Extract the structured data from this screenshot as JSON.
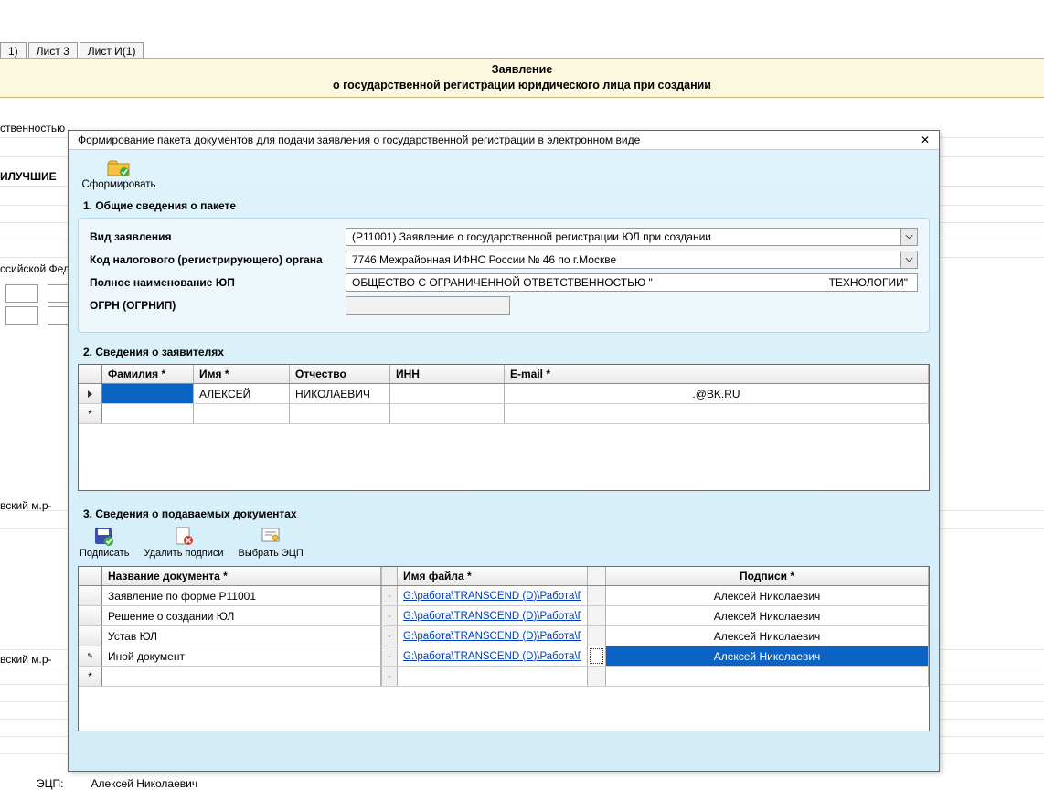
{
  "bg": {
    "tabs": [
      "1)",
      "Лист 3",
      "Лист И(1)"
    ],
    "title_line1": "Заявление",
    "title_line2": "о государственной регистрации юридического лица при создании",
    "cut1": "ственностью",
    "cut2": "ИЛУЧШИЕ",
    "cut3": "ссийской Фед",
    "cut4": "вский м.р-",
    "cut5": "вский м.р-",
    "ecp_label": "ЭЦП:",
    "ecp_value": "Алексей Николаевич"
  },
  "dialog": {
    "title": "Формирование пакета документов для подачи заявления о государственной регистрации в электронном виде",
    "toolbar": {
      "form_label": "Сформировать"
    },
    "section1": {
      "title": "1. Общие сведения о пакете",
      "labels": {
        "vid": "Вид заявления",
        "kod": "Код налогового (регистрирующего) органа",
        "name": "Полное наименование ЮП",
        "ogrn": "ОГРН (ОГРНИП)"
      },
      "values": {
        "vid": "(Р11001) Заявление о государственной регистрации ЮЛ при создании",
        "kod": "7746 Межрайонная ИФНС России № 46 по г.Москве",
        "name_left": "ОБЩЕСТВО С ОГРАНИЧЕННОЙ ОТВЕТСТВЕННОСТЬЮ \"",
        "name_right": "ТЕХНОЛОГИИ\"",
        "ogrn": ""
      }
    },
    "section2": {
      "title": "2. Сведения о заявителях",
      "headers": {
        "fam": "Фамилия *",
        "name": "Имя *",
        "ot": "Отчество",
        "inn": "ИНН",
        "email": "E-mail *"
      },
      "rows": [
        {
          "fam": "",
          "name": "АЛЕКСЕЙ",
          "ot": "НИКОЛАЕВИЧ",
          "inn": "",
          "email": ".@BK.RU"
        }
      ]
    },
    "section3": {
      "title": "3.  Сведения о подаваемых документах",
      "toolbar": {
        "sign": "Подписать",
        "unsign": "Удалить подписи",
        "choose": "Выбрать ЭЦП"
      },
      "headers": {
        "doc": "Название документа *",
        "file": "Имя файла *",
        "sign": "Подписи *"
      },
      "rows": [
        {
          "doc": "Заявление по форме Р11001",
          "file": "G:\\работа\\TRANSCEND (D)\\Работа\\П...",
          "sign": "Алексей Николаевич"
        },
        {
          "doc": "Решение о создании ЮЛ",
          "file": "G:\\работа\\TRANSCEND (D)\\Работа\\П...",
          "sign": "Алексей Николаевич"
        },
        {
          "doc": "Устав ЮЛ",
          "file": "G:\\работа\\TRANSCEND (D)\\Работа\\П...",
          "sign": "Алексей Николаевич"
        },
        {
          "doc": "Иной документ",
          "file": "G:\\работа\\TRANSCEND (D)\\Работа\\П...",
          "sign": "Алексей Николаевич",
          "selected": true
        }
      ]
    }
  }
}
